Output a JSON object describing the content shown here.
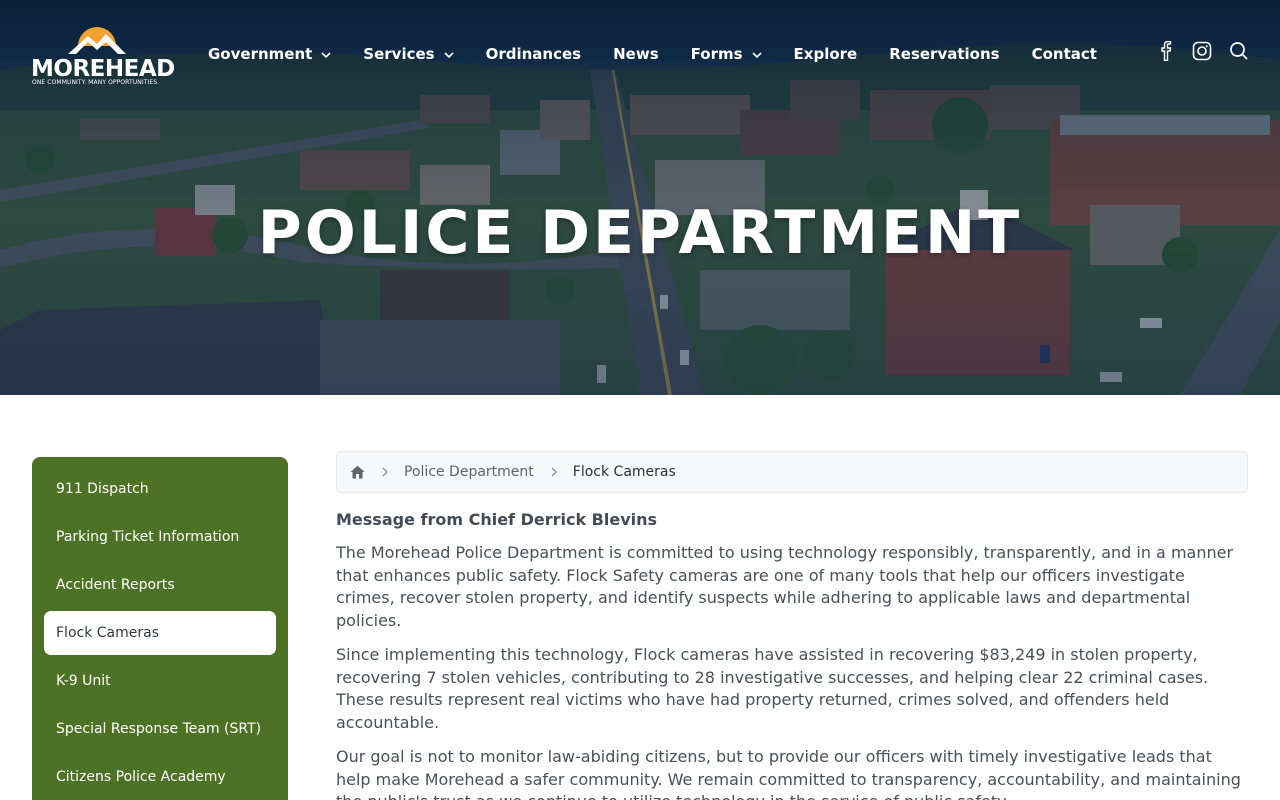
{
  "brand": {
    "name": "MOREHEAD",
    "tagline": "ONE COMMUNITY. MANY OPPORTUNITIES."
  },
  "nav": {
    "items": [
      {
        "label": "Government",
        "has_dropdown": true
      },
      {
        "label": "Services",
        "has_dropdown": true
      },
      {
        "label": "Ordinances",
        "has_dropdown": false
      },
      {
        "label": "News",
        "has_dropdown": false
      },
      {
        "label": "Forms",
        "has_dropdown": true
      },
      {
        "label": "Explore",
        "has_dropdown": false
      },
      {
        "label": "Reservations",
        "has_dropdown": false
      },
      {
        "label": "Contact",
        "has_dropdown": false
      }
    ],
    "icons": [
      "facebook-icon",
      "instagram-icon",
      "search-icon"
    ]
  },
  "hero": {
    "title": "POLICE DEPARTMENT"
  },
  "sidebar": {
    "items": [
      {
        "label": "911 Dispatch",
        "active": false
      },
      {
        "label": "Parking Ticket Information",
        "active": false
      },
      {
        "label": "Accident Reports",
        "active": false
      },
      {
        "label": "Flock Cameras",
        "active": true
      },
      {
        "label": "K-9 Unit",
        "active": false
      },
      {
        "label": "Special Response Team (SRT)",
        "active": false
      },
      {
        "label": "Citizens Police Academy",
        "active": false
      }
    ]
  },
  "breadcrumb": {
    "home_icon": "home-icon",
    "parent": "Police Department",
    "current": "Flock Cameras"
  },
  "content": {
    "heading": "Message from Chief Derrick Blevins",
    "paragraphs": [
      "The Morehead Police Department is committed to using technology responsibly, transparently, and in a manner that enhances public safety. Flock Safety cameras are one of many tools that help our officers investigate crimes, recover stolen property, and identify suspects while adhering to applicable laws and departmental policies.",
      "Since implementing this technology, Flock cameras have assisted in recovering $83,249 in stolen property, recovering 7 stolen vehicles, contributing to 28 investigative successes, and helping clear 22 criminal cases. These results represent real victims who have had property returned, crimes solved, and offenders held accountable.",
      "Our goal is not to monitor law-abiding citizens, but to provide our officers with timely investigative leads that help make Morehead a safer community. We remain committed to transparency, accountability, and maintaining the public's trust as we continue to utilize technology in the service of public safety."
    ]
  },
  "colors": {
    "sidebar_green": "#4e7225",
    "hero_overlay": "#14304f",
    "logo_sun": "#f0a330",
    "text": "#444b55"
  }
}
